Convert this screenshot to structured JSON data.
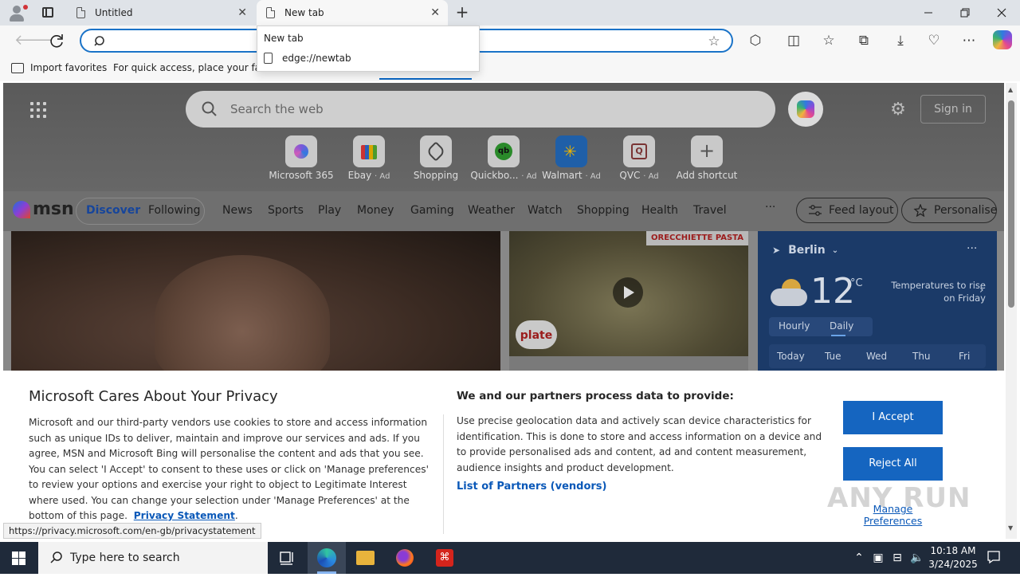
{
  "browser": {
    "tabs": [
      {
        "title": "Untitled",
        "close": "✕"
      },
      {
        "title": "New tab",
        "close": "✕"
      }
    ],
    "new_tab_symbol": "+",
    "window_controls": {
      "minimize": "—",
      "maximize": "❐",
      "close": "✕"
    },
    "address_bar": {
      "value": "",
      "placeholder": ""
    },
    "toolbar_icons": [
      "extensions-icon",
      "split-screen-icon",
      "favorites-icon",
      "collections-icon",
      "downloads-icon",
      "browser-essentials-icon",
      "more-icon",
      "copilot-icon"
    ],
    "favorites_bar": {
      "import": "Import favorites",
      "hint": "For quick access, place your favori"
    },
    "dropdown": {
      "heading": "New tab",
      "item": "edge://newtab"
    }
  },
  "msn_page": {
    "search_placeholder": "Search the web",
    "sign_in": "Sign in",
    "shortcuts": [
      {
        "label": "Microsoft 365",
        "ad": ""
      },
      {
        "label": "Ebay",
        "ad": "· Ad"
      },
      {
        "label": "Shopping",
        "ad": ""
      },
      {
        "label": "Quickbo...",
        "ad": "· Ad"
      },
      {
        "label": "Walmart",
        "ad": "· Ad"
      },
      {
        "label": "QVC",
        "ad": "· Ad"
      },
      {
        "label": "Add shortcut",
        "ad": ""
      }
    ],
    "brand": "msn",
    "nav": {
      "discover": "Discover",
      "following": "Following",
      "items": [
        "News",
        "Sports",
        "Play",
        "Money",
        "Gaming",
        "Weather",
        "Watch",
        "Shopping",
        "Health",
        "Travel"
      ],
      "more": "···",
      "feed_layout": "Feed layout",
      "personalise": "Personalise"
    },
    "food_card": {
      "banner": "ORECCHIETTE PASTA",
      "logo": "plate"
    },
    "weather": {
      "location": "Berlin",
      "more": "···",
      "temperature": "12",
      "unit": "°C",
      "note": "Temperatures to rise on Friday",
      "tab_hourly": "Hourly",
      "tab_daily": "Daily",
      "days": [
        "Today",
        "Tue",
        "Wed",
        "Thu",
        "Fri"
      ]
    }
  },
  "privacy": {
    "title": "Microsoft Cares About Your Privacy",
    "body": "Microsoft and our third-party vendors use cookies to store and access information such as unique IDs to deliver, maintain and improve our services and ads. If you agree, MSN and Microsoft Bing will personalise the content and ads that you see. You can select 'I Accept' to consent to these uses or click on 'Manage preferences' to review your options and exercise your right to object to Legitimate Interest where used.  You can change your selection under 'Manage Preferences' at the bottom of this page.",
    "link": "Privacy Statement",
    "link_suffix": ".",
    "heading2": "We and our partners process data to provide:",
    "body2": "Use precise geolocation data and actively scan device characteristics for identification. This is done to store and access information on a device and to provide personalised ads and content, ad and content measurement, audience insights and product development.",
    "partners_link": "List of Partners (vendors)",
    "accept": "I Accept",
    "reject": "Reject All",
    "manage": "Manage Preferences"
  },
  "status_url": "https://privacy.microsoft.com/en-gb/privacystatement",
  "watermark": "ANY RUN",
  "taskbar": {
    "search_placeholder": "Type here to search",
    "time": "10:18 AM",
    "date": "3/24/2025"
  },
  "colors": {
    "accent": "#1565c0",
    "address_border": "#1a73c8",
    "taskbar": "#1f2a3a"
  }
}
